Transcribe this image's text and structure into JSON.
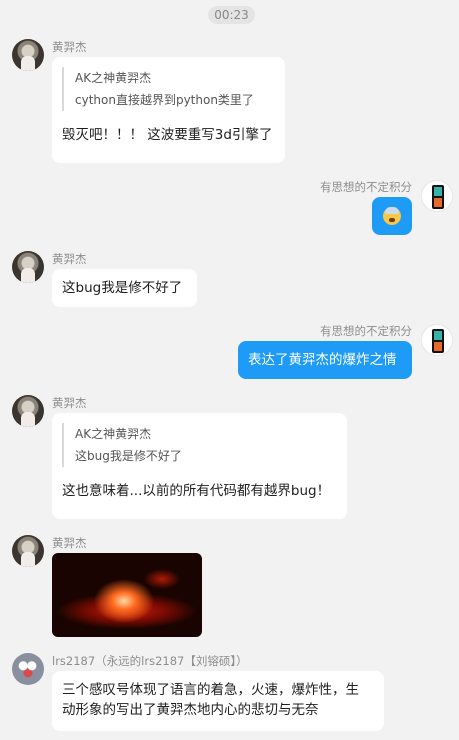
{
  "timestamp": "00:23",
  "messages": [
    {
      "sender": "黄羿杰",
      "quote_author": "AK之神黄羿杰",
      "quote_text": "cython直接越界到python类里了",
      "text": "毁灭吧！！！ 这波要重写3d引擎了"
    },
    {
      "sender": "有思想的不定积分",
      "emoji": "exploding-head-emoji"
    },
    {
      "sender": "黄羿杰",
      "text": "这bug我是修不好了"
    },
    {
      "sender": "有思想的不定积分",
      "text": "表达了黄羿杰的爆炸之情"
    },
    {
      "sender": "黄羿杰",
      "quote_author": "AK之神黄羿杰",
      "quote_text": "这bug我是修不好了",
      "text": "这也意味着...以前的所有代码都有越界bug！"
    },
    {
      "sender": "黄羿杰",
      "image": "explosion-image"
    },
    {
      "sender": "lrs2187（永远的lrs2187【刘镕硕】）",
      "text_lines": [
        "三个感叹号体现了语言的着急，火速，爆炸性，生",
        "动形象的写出了黄羿杰地内心的悲切与无奈"
      ]
    }
  ],
  "colors": {
    "background": "#f2f2f2",
    "self_bubble": "#1e9bf7",
    "other_bubble": "#ffffff"
  }
}
